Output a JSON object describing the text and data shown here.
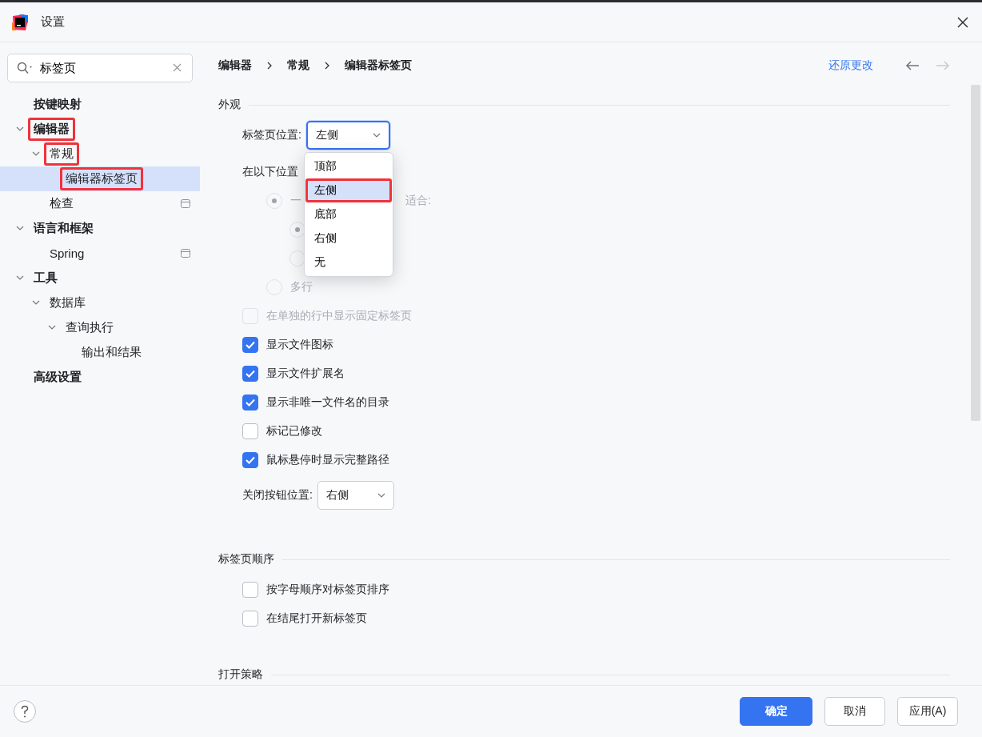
{
  "window": {
    "title": "设置"
  },
  "search": {
    "value": "标签页"
  },
  "sidebar": {
    "items": [
      {
        "label": "按键映射",
        "bold": true,
        "selected": false,
        "marked": false
      },
      {
        "label": "编辑器",
        "bold": true,
        "expanded": true,
        "selected": false,
        "marked": true,
        "children": [
          {
            "label": "常规",
            "bold": false,
            "expanded": true,
            "selected": false,
            "marked": true,
            "children": [
              {
                "label": "编辑器标签页",
                "bold": false,
                "selected": true,
                "marked": true
              }
            ]
          },
          {
            "label": "检查",
            "bold": false,
            "selected": false,
            "marked": false,
            "badge": true
          }
        ]
      },
      {
        "label": "语言和框架",
        "bold": true,
        "expanded": true,
        "selected": false,
        "marked": false,
        "children": [
          {
            "label": "Spring",
            "bold": false,
            "selected": false,
            "marked": false,
            "badge": true
          }
        ]
      },
      {
        "label": "工具",
        "bold": true,
        "expanded": true,
        "selected": false,
        "marked": false,
        "children": [
          {
            "label": "数据库",
            "bold": false,
            "expanded": true,
            "selected": false,
            "marked": false,
            "children": [
              {
                "label": "查询执行",
                "bold": false,
                "expanded": true,
                "selected": false,
                "marked": false,
                "children": [
                  {
                    "label": "输出和结果",
                    "bold": false,
                    "selected": false,
                    "marked": false
                  }
                ]
              }
            ]
          }
        ]
      },
      {
        "label": "高级设置",
        "bold": true,
        "selected": false,
        "marked": false
      }
    ]
  },
  "breadcrumb": [
    "编辑器",
    "常规",
    "编辑器标签页"
  ],
  "reset_link": "还原更改",
  "nav": {
    "back_disabled": false,
    "forward_disabled": true
  },
  "sections": [
    {
      "title": "外观",
      "items": [
        {
          "kind": "combo",
          "label": "标签页位置:",
          "value": "左侧",
          "focused": true,
          "open": true,
          "options": [
            {
              "label": "顶部",
              "selected": false,
              "marked": false
            },
            {
              "label": "左侧",
              "selected": true,
              "marked": true
            },
            {
              "label": "底部",
              "selected": false,
              "marked": false
            },
            {
              "label": "右侧",
              "selected": false,
              "marked": false
            },
            {
              "label": "无",
              "selected": false,
              "marked": false
            }
          ]
        },
        {
          "kind": "text",
          "label": "在以下位置"
        },
        {
          "kind": "radio",
          "label": "一",
          "tail": "适合:",
          "selected": true,
          "disabled": true,
          "children": [
            {
              "selected": true,
              "disabled": true
            },
            {
              "selected": false,
              "disabled": true
            }
          ]
        },
        {
          "kind": "radio",
          "label": "多行",
          "selected": false,
          "disabled": true
        },
        {
          "kind": "checkbox",
          "label": "在单独的行中显示固定标签页",
          "checked": false,
          "disabled": true
        },
        {
          "kind": "checkbox",
          "label": "显示文件图标",
          "checked": true,
          "disabled": false
        },
        {
          "kind": "checkbox",
          "label": "显示文件扩展名",
          "checked": true,
          "disabled": false
        },
        {
          "kind": "checkbox",
          "label": "显示非唯一文件名的目录",
          "checked": true,
          "disabled": false
        },
        {
          "kind": "checkbox",
          "label": "标记已修改",
          "checked": false,
          "disabled": false
        },
        {
          "kind": "checkbox",
          "label": "鼠标悬停时显示完整路径",
          "checked": true,
          "disabled": false
        },
        {
          "kind": "combo",
          "label": "关闭按钮位置:",
          "value": "右侧",
          "focused": false
        }
      ]
    },
    {
      "title": "标签页顺序",
      "items": [
        {
          "kind": "checkbox",
          "label": "按字母顺序对标签页排序",
          "checked": false,
          "disabled": false
        },
        {
          "kind": "checkbox",
          "label": "在结尾打开新标签页",
          "checked": false,
          "disabled": false
        }
      ]
    },
    {
      "title": "打开策略"
    }
  ],
  "footer": {
    "buttons": [
      {
        "label": "确定",
        "primary": true
      },
      {
        "label": "取消",
        "primary": false
      },
      {
        "label": "应用(A)",
        "primary": false
      }
    ]
  }
}
